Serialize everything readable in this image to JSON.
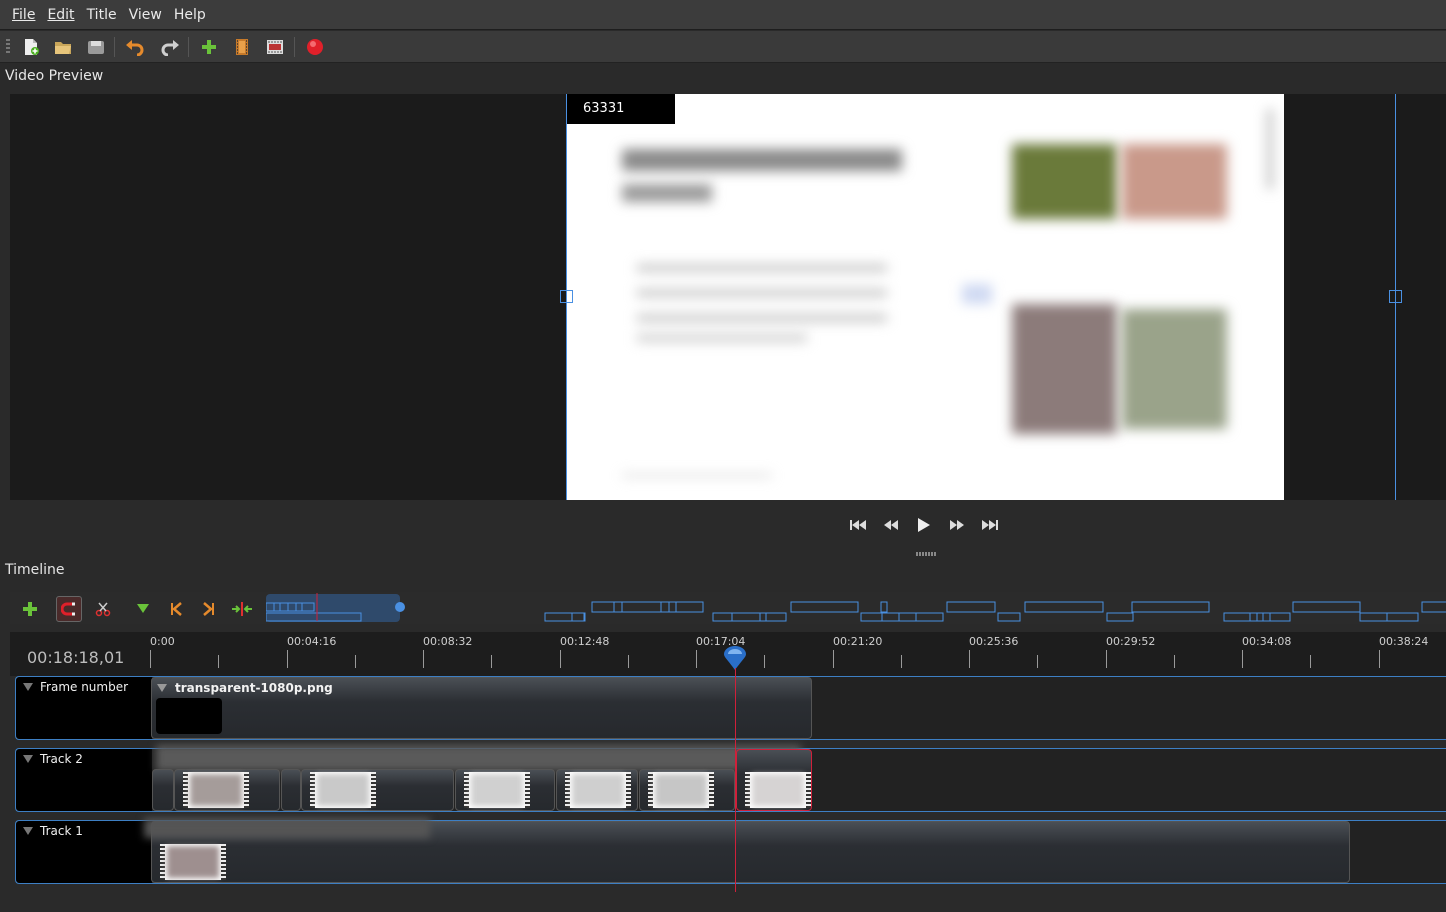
{
  "menu": [
    "File",
    "Edit",
    "Title",
    "View",
    "Help"
  ],
  "toolbar": {
    "icons": [
      "new-project-icon",
      "open-project-icon",
      "save-project-icon",
      "undo-icon",
      "redo-icon",
      "import-files-icon",
      "profile-icon",
      "fullscreen-icon",
      "export-video-icon"
    ]
  },
  "preview": {
    "label": "Video Preview",
    "frame_number": "63331"
  },
  "transport": [
    "jump-start-icon",
    "rewind-icon",
    "play-icon",
    "fast-forward-icon",
    "jump-end-icon"
  ],
  "timeline": {
    "label": "Timeline",
    "timecode": "00:18:18,01",
    "ticks": [
      "0:00",
      "00:04:16",
      "00:08:32",
      "00:12:48",
      "00:17:04",
      "00:21:20",
      "00:25:36",
      "00:29:52",
      "00:34:08",
      "00:38:24"
    ],
    "tracks": [
      {
        "name": "Frame number",
        "clip_title": "transparent-1080p.png"
      },
      {
        "name": "Track 2"
      },
      {
        "name": "Track 1"
      }
    ]
  },
  "colors": {
    "accent": "#4a90e2",
    "playhead": "#d0203a",
    "background": "#2a2a2a"
  }
}
